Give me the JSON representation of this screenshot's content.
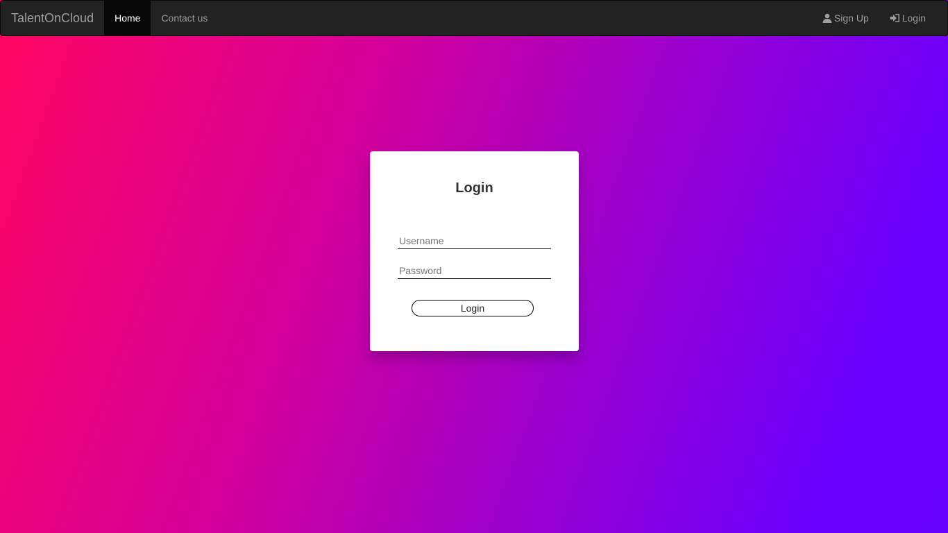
{
  "navbar": {
    "brand": "TalentOnCloud",
    "left_items": [
      {
        "label": "Home",
        "active": true
      },
      {
        "label": "Contact us",
        "active": false
      }
    ],
    "right_items": [
      {
        "label": "Sign Up",
        "icon": "user-icon"
      },
      {
        "label": "Login",
        "icon": "log-in-icon"
      }
    ]
  },
  "login_card": {
    "title": "Login",
    "username_placeholder": "Username",
    "password_placeholder": "Password",
    "button_label": "Login"
  },
  "colors": {
    "navbar_bg": "#222222",
    "active_nav_bg": "#080808",
    "gradient_start": "#ff0660",
    "gradient_end": "#6600ff"
  }
}
